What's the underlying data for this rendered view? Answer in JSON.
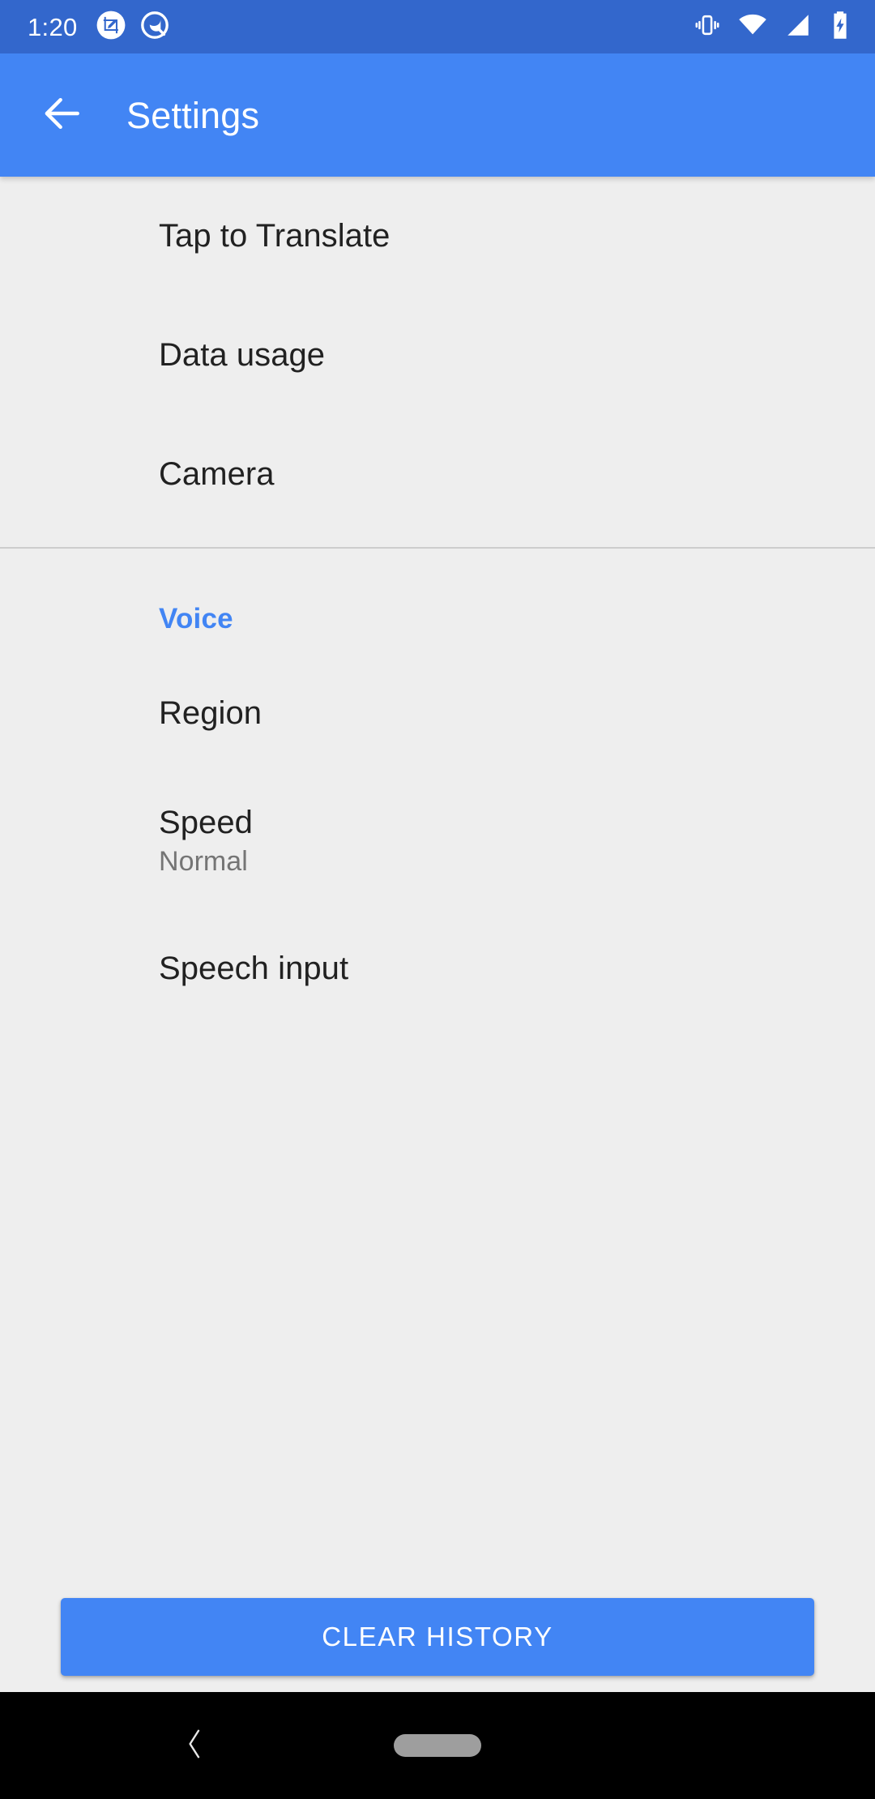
{
  "status_bar": {
    "clock": "1:20",
    "left_icons": [
      {
        "name": "screenshot-markup-icon"
      },
      {
        "name": "assistant-circle-icon"
      }
    ],
    "right_icons": [
      {
        "name": "vibrate-icon"
      },
      {
        "name": "wifi-icon"
      },
      {
        "name": "cellular-signal-icon"
      },
      {
        "name": "battery-charging-icon"
      }
    ],
    "background_color": "#3367CC"
  },
  "app_bar": {
    "title": "Settings",
    "back_icon": "arrow-back-icon",
    "background_color": "#4285F4",
    "text_color": "#FFFFFF"
  },
  "preferences": {
    "general_items": [
      {
        "title": "Tap to Translate"
      },
      {
        "title": "Data usage"
      },
      {
        "title": "Camera"
      }
    ],
    "voice_section": {
      "header": "Voice",
      "header_color": "#4285F4",
      "items": [
        {
          "title": "Region",
          "summary": ""
        },
        {
          "title": "Speed",
          "summary": "Normal"
        },
        {
          "title": "Speech input",
          "summary": ""
        }
      ]
    }
  },
  "bottom_action": {
    "label": "CLEAR HISTORY",
    "background_color": "#4285F4",
    "text_color": "#FFFFFF"
  },
  "nav_bar": {
    "back_icon": "nav-back-chevron-icon",
    "home_icon": "nav-home-pill-icon",
    "background_color": "#000000"
  }
}
